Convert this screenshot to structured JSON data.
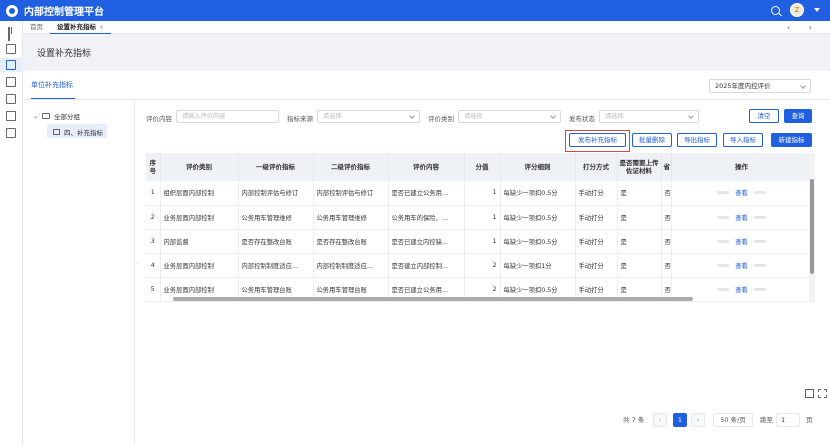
{
  "app": {
    "title": "内部控制管理平台",
    "avatar_letter": "Z"
  },
  "tabs": [
    {
      "label": "首页"
    },
    {
      "label": "设置补充指标",
      "close": "×"
    }
  ],
  "tab_nav": "‹ ›",
  "page_title": "设置补充指标",
  "sub_tab": "单位补充指标",
  "year_select": "2025年度内控评价",
  "tree": {
    "root": "全部分组",
    "child": "四、补充指标"
  },
  "filters": {
    "content_label": "评价内容",
    "content_placeholder": "请输入评价内容",
    "source_label": "指标来源",
    "source_placeholder": "请选择",
    "category_label": "评价类别",
    "category_placeholder": "请选择",
    "status_label": "发布状态",
    "status_placeholder": "请选择"
  },
  "buttons": {
    "clear": "清空",
    "query": "查询",
    "publish": "发布补充指标",
    "batch_delete": "批量删除",
    "export": "导出指标",
    "import": "导入指标",
    "create": "新建指标"
  },
  "table": {
    "headers": [
      "序号",
      "评价类别",
      "一级评价指标",
      "二级评价指标",
      "评价内容",
      "分值",
      "评分细则",
      "打分方式",
      "是否需要上传佐证材料",
      "省",
      "操作"
    ],
    "rows": [
      {
        "no": "1",
        "cat": "组织层面内部控制",
        "l1": "内部控制评估与修订",
        "l2": "内部控制评估与修订",
        "content": "是否已建立公务用…",
        "score": "1",
        "rule": "每缺少一项扣0.5分",
        "method": "手动打分",
        "upload": "是",
        "extra": "否",
        "action": "查看"
      },
      {
        "no": "2",
        "cat": "业务层面内部控制",
        "l1": "公务用车管理维修",
        "l2": "公务用车管理维修",
        "content": "公务用车的保险、…",
        "score": "1",
        "rule": "每缺少一项扣0.5分",
        "method": "手动打分",
        "upload": "是",
        "extra": "否",
        "action": "查看"
      },
      {
        "no": "3",
        "cat": "内部监督",
        "l1": "是否存在整改台账",
        "l2": "是否存在整改台账",
        "content": "是否已建立内控缺…",
        "score": "1",
        "rule": "每缺少一项扣0.5分",
        "method": "手动打分",
        "upload": "是",
        "extra": "否",
        "action": "查看"
      },
      {
        "no": "4",
        "cat": "业务层面内部控制",
        "l1": "内部控制制度适应…",
        "l2": "内部控制制度适应…",
        "content": "是否建立内部控制…",
        "score": "2",
        "rule": "每缺少一项扣1分",
        "method": "手动打分",
        "upload": "是",
        "extra": "否",
        "action": "查看"
      },
      {
        "no": "5",
        "cat": "业务层面内部控制",
        "l1": "公务用车管理台账",
        "l2": "公务用车管理台账",
        "content": "是否已建立公务用…",
        "score": "2",
        "rule": "每缺少一项扣0.5分",
        "method": "手动打分",
        "upload": "是",
        "extra": "否",
        "action": "查看"
      }
    ]
  },
  "pagination": {
    "total": "共 7 条",
    "prev": "‹",
    "current": "1",
    "next": "›",
    "page_size": "50 条/页",
    "jump_label": "跳至",
    "jump_value": "1",
    "page_unit": "页"
  },
  "colors": {
    "primary": "#1f5fe0",
    "highlight": "#e0443c"
  }
}
